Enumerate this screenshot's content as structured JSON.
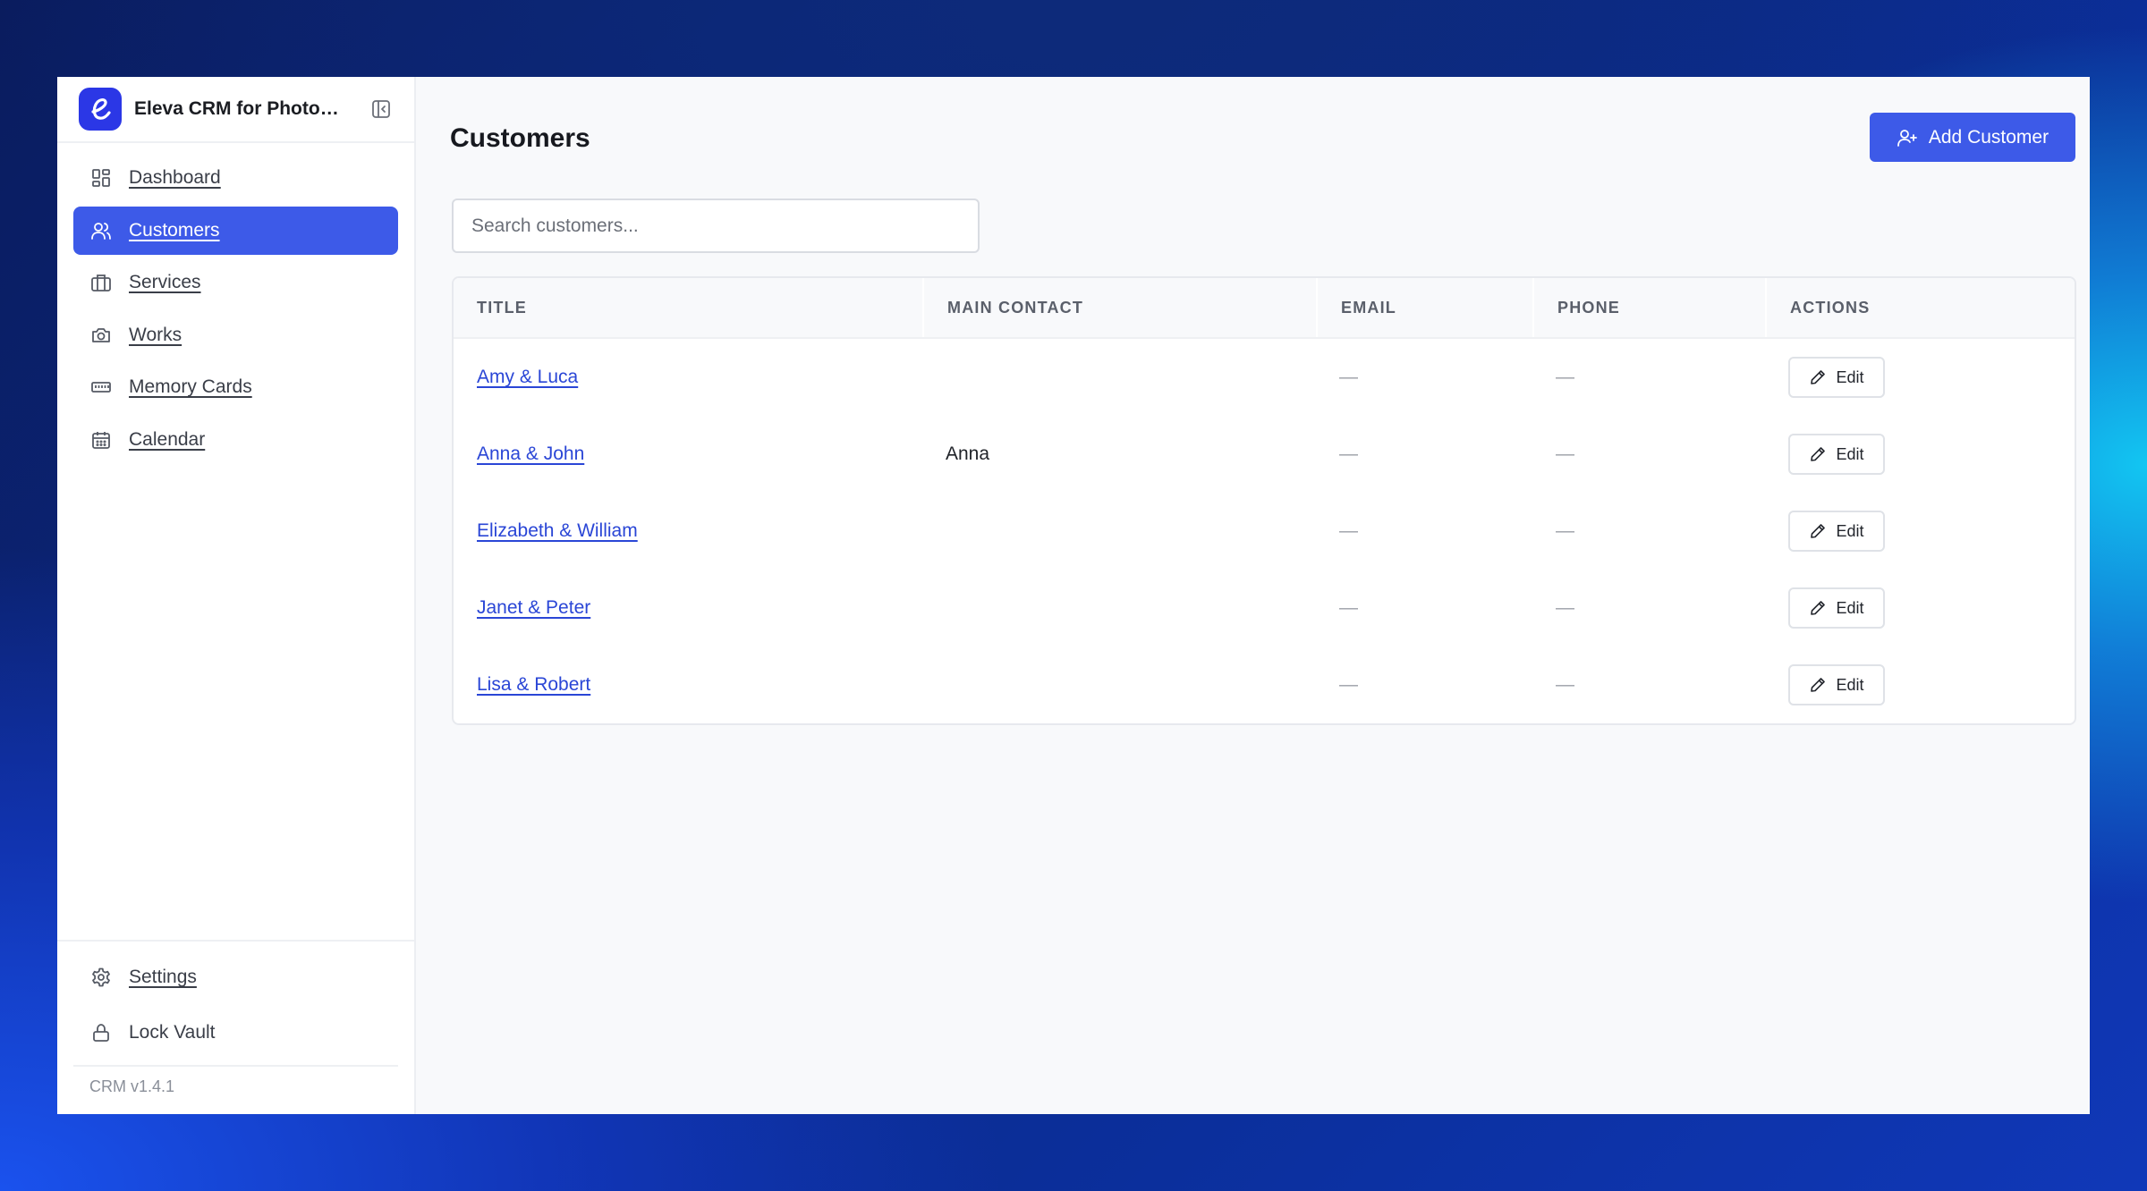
{
  "app": {
    "name": "Eleva CRM for Photogr…",
    "version": "CRM v1.4.1"
  },
  "sidebar": {
    "items": [
      {
        "label": "Dashboard",
        "icon": "dashboard-icon"
      },
      {
        "label": "Customers",
        "icon": "users-icon",
        "active": true
      },
      {
        "label": "Services",
        "icon": "briefcase-icon"
      },
      {
        "label": "Works",
        "icon": "camera-icon"
      },
      {
        "label": "Memory Cards",
        "icon": "memory-card-icon"
      },
      {
        "label": "Calendar",
        "icon": "calendar-icon"
      }
    ],
    "bottom": [
      {
        "label": "Settings",
        "icon": "gear-icon"
      },
      {
        "label": "Lock Vault",
        "icon": "lock-icon"
      }
    ]
  },
  "main": {
    "title": "Customers",
    "add_button": "Add Customer",
    "search_placeholder": "Search customers...",
    "table": {
      "columns": [
        "TITLE",
        "MAIN CONTACT",
        "EMAIL",
        "PHONE",
        "ACTIONS"
      ],
      "rows": [
        {
          "title": "Amy & Luca",
          "contact": "",
          "email": "—",
          "phone": "—",
          "action": "Edit"
        },
        {
          "title": "Anna & John",
          "contact": "Anna",
          "email": "—",
          "phone": "—",
          "action": "Edit"
        },
        {
          "title": "Elizabeth & William",
          "contact": "",
          "email": "—",
          "phone": "—",
          "action": "Edit"
        },
        {
          "title": "Janet & Peter",
          "contact": "",
          "email": "—",
          "phone": "—",
          "action": "Edit"
        },
        {
          "title": "Lisa & Robert",
          "contact": "",
          "email": "—",
          "phone": "—",
          "action": "Edit"
        }
      ]
    }
  },
  "colors": {
    "accent": "#3d5ae8",
    "link": "#2a46d6",
    "logo": "#2b37e6"
  }
}
